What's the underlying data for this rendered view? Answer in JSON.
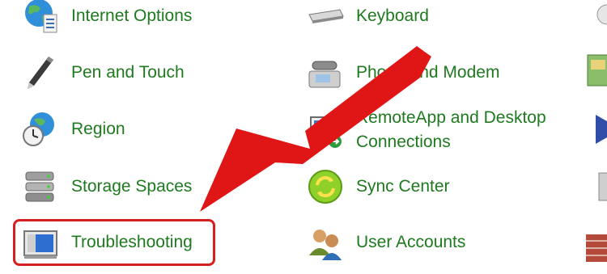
{
  "left_column": [
    {
      "label": "Internet Options",
      "icon": "internet-options-icon"
    },
    {
      "label": "Pen and Touch",
      "icon": "pen-icon"
    },
    {
      "label": "Region",
      "icon": "region-globe-clock-icon"
    },
    {
      "label": "Storage Spaces",
      "icon": "storage-spaces-icon"
    },
    {
      "label": "Troubleshooting",
      "icon": "troubleshooting-icon"
    }
  ],
  "middle_column": [
    {
      "label": "Keyboard",
      "icon": "keyboard-icon"
    },
    {
      "label": "Phone and Modem",
      "icon": "phone-modem-icon"
    },
    {
      "label": "RemoteApp and Desktop Connections",
      "icon": "remoteapp-icon"
    },
    {
      "label": "Sync Center",
      "icon": "sync-center-icon"
    },
    {
      "label": "User Accounts",
      "icon": "user-accounts-icon"
    }
  ],
  "colors": {
    "link_text": "#1e7a1e",
    "annotation_red": "#d62020",
    "background": "#ffffff"
  }
}
